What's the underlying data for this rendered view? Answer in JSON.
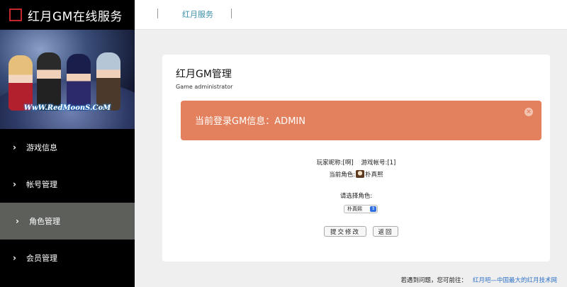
{
  "app": {
    "title": "红月GM在线服务"
  },
  "banner": {
    "caption": "WwW.RedMoonS.CoM"
  },
  "sidebar": {
    "items": [
      {
        "label": "游戏信息",
        "chevron": "›",
        "icon": "chevron-right-icon"
      },
      {
        "label": "帐号管理",
        "chevron": "›",
        "icon": "chevron-right-icon"
      },
      {
        "label": "角色管理",
        "chevron": "›",
        "icon": "chevron-right-icon",
        "active": true
      },
      {
        "label": "会员管理",
        "chevron": "›",
        "icon": "chevron-right-icon"
      }
    ]
  },
  "topbar": {
    "link": "红月服务"
  },
  "card": {
    "title": "红月GM管理",
    "subtitle": "Game administrator",
    "alert": {
      "text": "当前登录GM信息：ADMIN",
      "close": "×"
    },
    "player_nick": "玩家昵称:[啊]",
    "game_account": "游戏帐号:[1]",
    "current_role_label": "当前角色:",
    "current_role_value": "朴真熙",
    "select_label": "请选择角色:",
    "select_value": "朴真熙",
    "select_arrow": "⇕",
    "submit_label": "提交修改",
    "back_label": "返回"
  },
  "footer": {
    "text": "若遇到问题，您可前往：",
    "link": "红月吧—中国最大的红月技术网"
  },
  "colors": {
    "sidebar": "#000000",
    "active_item": "#5d5f5b",
    "alert": "#e3805d",
    "brand_red": "#c3272b",
    "link": "#3b8ea8"
  }
}
